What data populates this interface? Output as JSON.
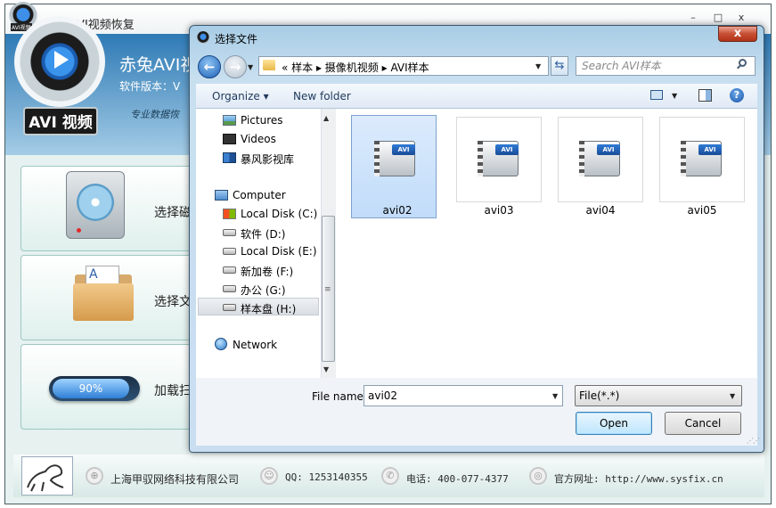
{
  "app": {
    "title": "赤兔AVI视频恢复",
    "logo_small_text": "AVI视频",
    "window_min": "–",
    "window_max": "□",
    "window_close": "x",
    "logo_badge": "AVI 视频",
    "brand": "赤兔AVI视",
    "version_label": "软件版本：V",
    "slogan": "专业数据恢",
    "menu": [
      {
        "label": "选择磁",
        "icon": "hard-disk-icon"
      },
      {
        "label": "选择文",
        "icon": "folder-document-icon"
      },
      {
        "label": "加载扫",
        "icon": "progress-capsule-icon",
        "progress_text": "90%",
        "progress_value": 0.9
      }
    ],
    "footer": {
      "company": "上海甲驭网络科技有限公司",
      "qq": "QQ: 1253140355",
      "phone": "电话: 400-077-4377",
      "website": "官方网址: http://www.sysfix.cn"
    }
  },
  "dialog": {
    "title": "选择文件",
    "close_glyph": "x",
    "nav_back_glyph": "←",
    "nav_forward_glyph": "→",
    "address_path": "«  样本  ▸  摄像机视频  ▸  AVI样本",
    "refresh_glyph": "⇆",
    "search_placeholder": "Search AVI样本",
    "toolbar": {
      "organize": "Organize ▾",
      "new_folder": "New folder",
      "help_glyph": "?"
    },
    "nav_items": [
      {
        "label": "Pictures",
        "icon": "pictures-icon"
      },
      {
        "label": "Videos",
        "icon": "videos-icon"
      },
      {
        "label": "暴风影视库",
        "icon": "library-icon"
      },
      {
        "label": "Computer",
        "icon": "computer-icon"
      },
      {
        "label": "Local Disk (C:)",
        "icon": "windows-drive-icon"
      },
      {
        "label": "软件 (D:)",
        "icon": "drive-icon"
      },
      {
        "label": "Local Disk (E:)",
        "icon": "drive-icon"
      },
      {
        "label": "新加卷 (F:)",
        "icon": "drive-icon"
      },
      {
        "label": "办公 (G:)",
        "icon": "drive-icon"
      },
      {
        "label": "样本盘 (H:)",
        "icon": "drive-icon",
        "selected": true
      },
      {
        "label": "Network",
        "icon": "network-icon"
      }
    ],
    "files": [
      {
        "name": "avi02",
        "badge": "AVI",
        "selected": true
      },
      {
        "name": "avi03",
        "badge": "AVI"
      },
      {
        "name": "avi04",
        "badge": "AVI"
      },
      {
        "name": "avi05",
        "badge": "AVI"
      }
    ],
    "file_name_label": "File name:",
    "file_name_value": "avi02",
    "file_type_value": "File(*.*)",
    "open_label": "Open",
    "cancel_label": "Cancel"
  }
}
